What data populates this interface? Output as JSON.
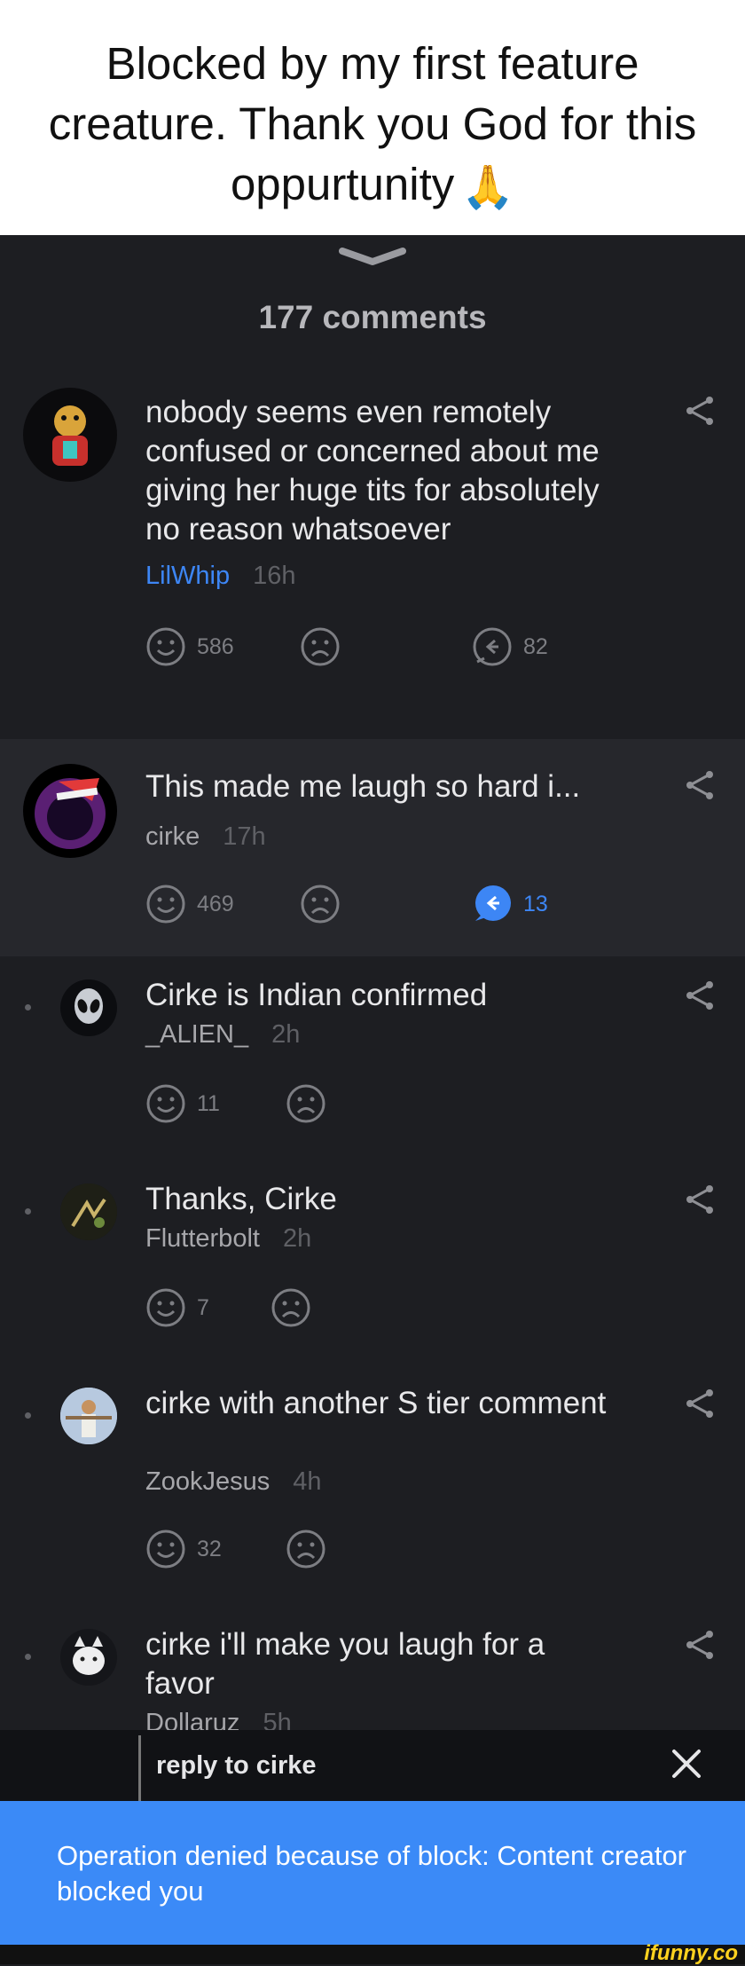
{
  "caption": {
    "text": "Blocked by my first feature creature. Thank you God for this oppurtunity",
    "emoji": "🙏"
  },
  "comments_header": {
    "count_label": "177 comments"
  },
  "comments": [
    {
      "text": "nobody seems even remotely confused or concerned about me giving her huge tits for absolutely no reason whatsoever",
      "user": "LilWhip",
      "time": "16h",
      "smile_count": "586",
      "reply_count": "82",
      "avatar_icon": "character-avatar-icon"
    },
    {
      "text": "This made me laugh so hard i...",
      "user": "cirke",
      "time": "17h",
      "smile_count": "469",
      "reply_count": "13",
      "avatar_icon": "santa-hat-avatar-icon"
    },
    {
      "text": "Cirke is Indian confirmed",
      "user": "_ALIEN_",
      "time": "2h",
      "smile_count": "11",
      "avatar_icon": "alien-avatar-icon"
    },
    {
      "text": "Thanks, Cirke",
      "user": "Flutterbolt",
      "time": "2h",
      "smile_count": "7",
      "avatar_icon": "poster-avatar-icon"
    },
    {
      "text": "cirke with another S tier comment",
      "user": "ZookJesus",
      "time": "4h",
      "smile_count": "32",
      "avatar_icon": "jesus-avatar-icon"
    },
    {
      "text": "cirke i'll make you laugh for a favor",
      "user": "Dollaruz",
      "time": "5h",
      "avatar_icon": "cat-avatar-icon"
    }
  ],
  "reply_bar": {
    "label": "reply to cirke"
  },
  "toast": {
    "message": "Operation denied because of block: Content creator blocked you"
  },
  "watermark": {
    "text": "ifunny.co"
  },
  "colors": {
    "accent": "#3b8af7",
    "username_blue": "#3d86f5",
    "background": "#1d1e22",
    "highlight": "#26272c"
  }
}
